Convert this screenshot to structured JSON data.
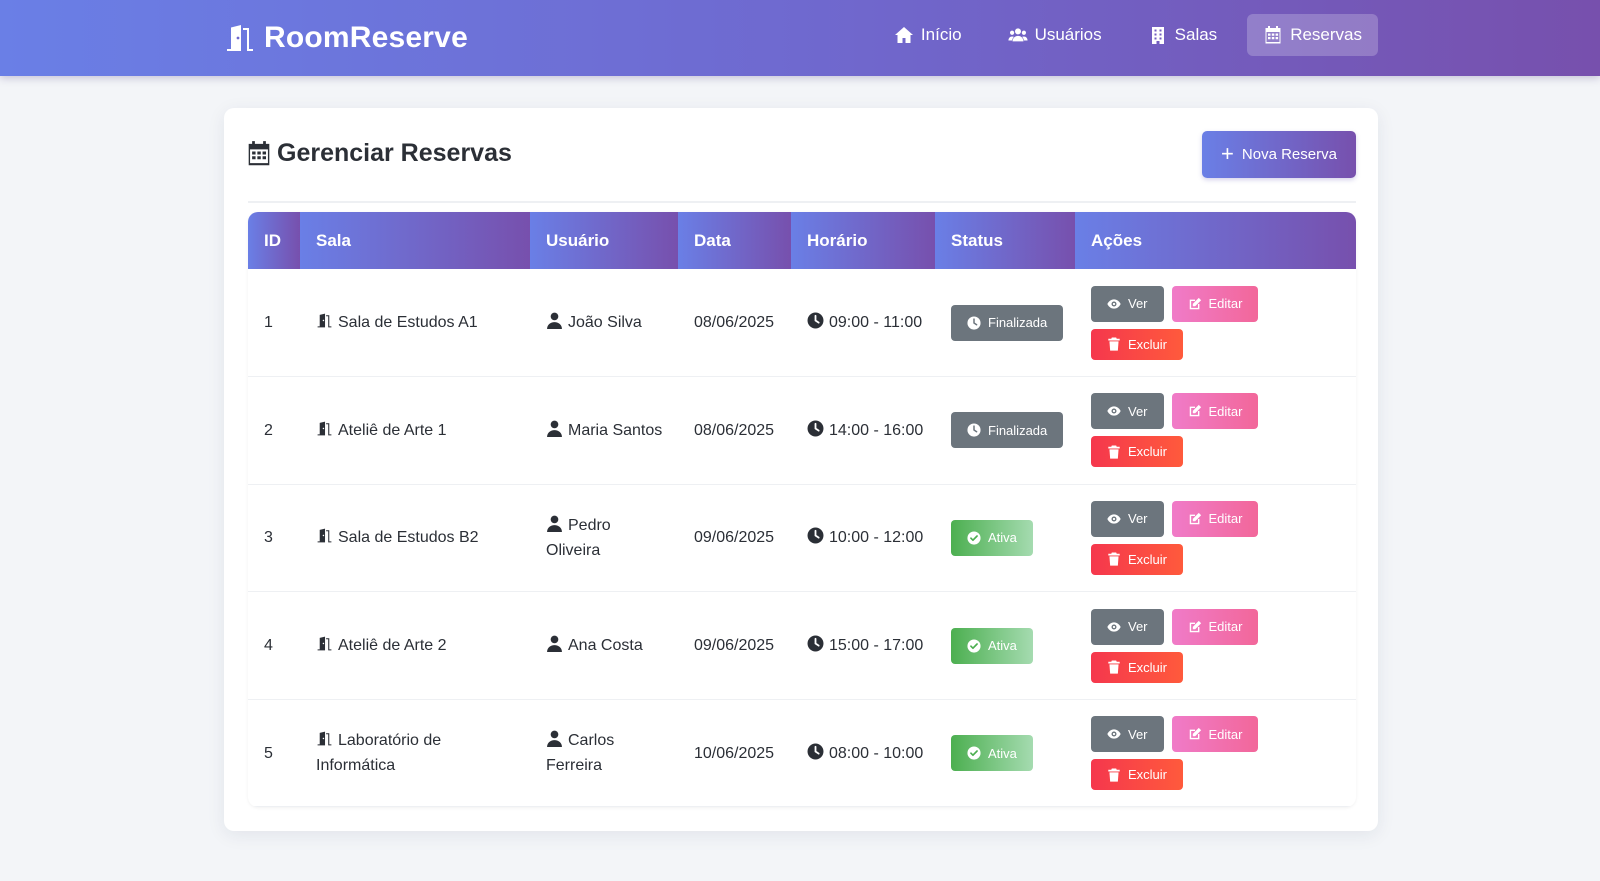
{
  "app": {
    "brand": "RoomReserve",
    "nav": [
      {
        "label": "Início",
        "icon": "home-icon",
        "active": false
      },
      {
        "label": "Usuários",
        "icon": "users-icon",
        "active": false
      },
      {
        "label": "Salas",
        "icon": "building-icon",
        "active": false
      },
      {
        "label": "Reservas",
        "icon": "calendar-icon",
        "active": true
      }
    ]
  },
  "page": {
    "title": "Gerenciar Reservas",
    "new_button": "Nova Reserva"
  },
  "table": {
    "columns": [
      "ID",
      "Sala",
      "Usuário",
      "Data",
      "Horário",
      "Status",
      "Ações"
    ],
    "actions": {
      "view": "Ver",
      "edit": "Editar",
      "delete": "Excluir"
    },
    "rows": [
      {
        "id": "1",
        "sala": "Sala de Estudos A1",
        "usuario": "João Silva",
        "data": "08/06/2025",
        "horario": "09:00 - 11:00",
        "status": "Finalizada"
      },
      {
        "id": "2",
        "sala": "Ateliê de Arte 1",
        "usuario": "Maria Santos",
        "data": "08/06/2025",
        "horario": "14:00 - 16:00",
        "status": "Finalizada"
      },
      {
        "id": "3",
        "sala": "Sala de Estudos B2",
        "usuario": "Pedro Oliveira",
        "data": "09/06/2025",
        "horario": "10:00 - 12:00",
        "status": "Ativa"
      },
      {
        "id": "4",
        "sala": "Ateliê de Arte 2",
        "usuario": "Ana Costa",
        "data": "09/06/2025",
        "horario": "15:00 - 17:00",
        "status": "Ativa"
      },
      {
        "id": "5",
        "sala": "Laboratório de Informática",
        "usuario": "Carlos Ferreira",
        "data": "10/06/2025",
        "horario": "08:00 - 10:00",
        "status": "Ativa"
      }
    ]
  },
  "colors": {
    "gradient_start": "#6a7fe6",
    "gradient_end": "#7750ad",
    "status_finalizada": "#6c757d",
    "status_ativa": "#4caf50",
    "button_edit": "#f07bc8",
    "button_delete": "#f5374d"
  }
}
